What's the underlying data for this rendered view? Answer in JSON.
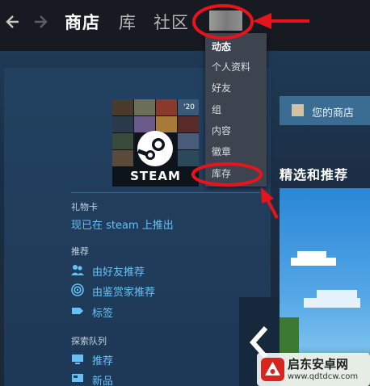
{
  "nav": {
    "tabs": [
      {
        "label": "商店",
        "active": true
      },
      {
        "label": "库",
        "active": false
      },
      {
        "label": "社区",
        "active": false
      }
    ]
  },
  "dropdown": {
    "items": [
      "动态",
      "个人资料",
      "好友",
      "组",
      "内容",
      "徽章",
      "库存"
    ]
  },
  "sidebar": {
    "gift_title": "礼物卡",
    "gift_link": "现已在 steam 上推出",
    "recommend_title": "推荐",
    "recommend_links": [
      "由好友推荐",
      "由鉴赏家推荐",
      "标签"
    ],
    "queue_title": "探索队列",
    "queue_links": [
      "推荐",
      "新品"
    ]
  },
  "card": {
    "label": "STEAM",
    "badge": "'20"
  },
  "right": {
    "store_label": "您的商店",
    "featured_title": "精选和推荐"
  },
  "watermark": {
    "title": "启东安卓网",
    "url": "www.qdtdcw.com"
  },
  "colors": {
    "annotation_red": "#e8141c",
    "link_blue": "#67c1f5",
    "topbar": "#171a21"
  }
}
